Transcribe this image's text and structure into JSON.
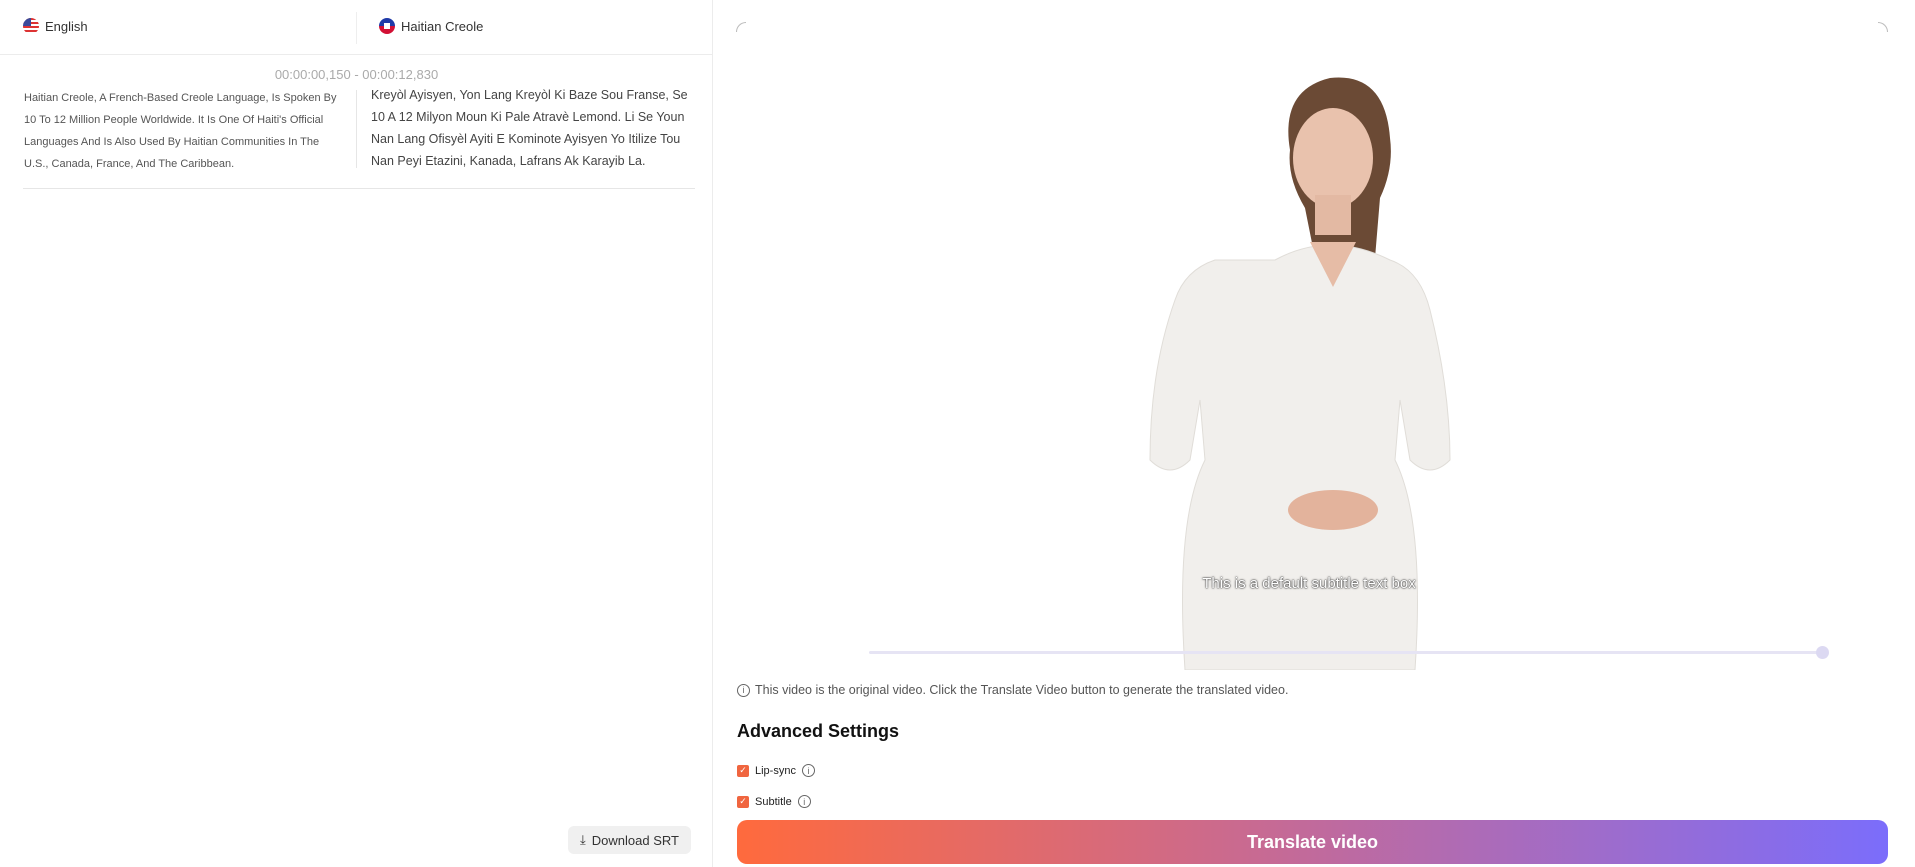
{
  "header": {
    "source_lang": "English",
    "target_lang": "Haitian Creole"
  },
  "segment": {
    "time": "00:00:00,150 - 00:00:12,830",
    "source": "Haitian Creole, A French-Based Creole Language, Is Spoken By 10 To 12 Million People Worldwide. It Is One Of Haiti's Official Languages And Is Also Used By Haitian Communities In The U.S., Canada, France, And The Caribbean.",
    "target": "Kreyòl Ayisyen, Yon Lang Kreyòl Ki Baze Sou Franse, Se 10 A 12 Milyon Moun Ki Pale Atravè Lemond. Li Se Youn Nan Lang Ofisyèl Ayiti E Kominote Ayisyen Yo Itilize Tou Nan Peyi Etazini, Kanada, Lafrans Ak Karayib La."
  },
  "download_label": "Download SRT",
  "video": {
    "subtitle": "This is a default subtitle text box",
    "progress": 1.0
  },
  "info_text": "This video is the original video. Click the Translate Video button to generate the translated video.",
  "advanced": {
    "title": "Advanced Settings",
    "options": [
      {
        "label": "Lip-sync",
        "checked": true
      },
      {
        "label": "Subtitle",
        "checked": true
      }
    ]
  },
  "translate_label": "Translate video",
  "colors": {
    "accent": "#f0653f",
    "gradient_start": "#ff6a3d",
    "gradient_end": "#7b6dfb"
  }
}
